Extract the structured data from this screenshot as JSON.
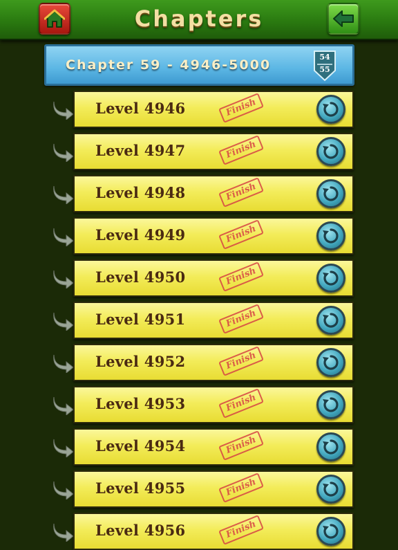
{
  "header": {
    "title": "Chapters",
    "home_icon": "home-icon",
    "back_icon": "back-arrow-icon"
  },
  "chapter": {
    "title": "Chapter 59 - 4946-5000",
    "badge_top": "54",
    "badge_bottom": "55"
  },
  "colors": {
    "header_green": "#2a7a10",
    "home_red": "#c8261a",
    "back_green": "#3fae20",
    "chapter_blue": "#5bb6e4",
    "row_yellow": "#f3ec5a",
    "level_text": "#4a2a12",
    "stamp_red": "#d64444",
    "replay_teal": "#43a8bf"
  },
  "levels": [
    {
      "label": "Level 4946",
      "stamp": "Finish",
      "icon": "replay-icon"
    },
    {
      "label": "Level 4947",
      "stamp": "Finish",
      "icon": "replay-icon"
    },
    {
      "label": "Level 4948",
      "stamp": "Finish",
      "icon": "replay-icon"
    },
    {
      "label": "Level 4949",
      "stamp": "Finish",
      "icon": "replay-icon"
    },
    {
      "label": "Level 4950",
      "stamp": "Finish",
      "icon": "replay-icon"
    },
    {
      "label": "Level 4951",
      "stamp": "Finish",
      "icon": "replay-icon"
    },
    {
      "label": "Level 4952",
      "stamp": "Finish",
      "icon": "replay-icon"
    },
    {
      "label": "Level 4953",
      "stamp": "Finish",
      "icon": "replay-icon"
    },
    {
      "label": "Level 4954",
      "stamp": "Finish",
      "icon": "replay-icon"
    },
    {
      "label": "Level 4955",
      "stamp": "Finish",
      "icon": "replay-icon"
    },
    {
      "label": "Level 4956",
      "stamp": "Finish",
      "icon": "replay-icon"
    }
  ]
}
